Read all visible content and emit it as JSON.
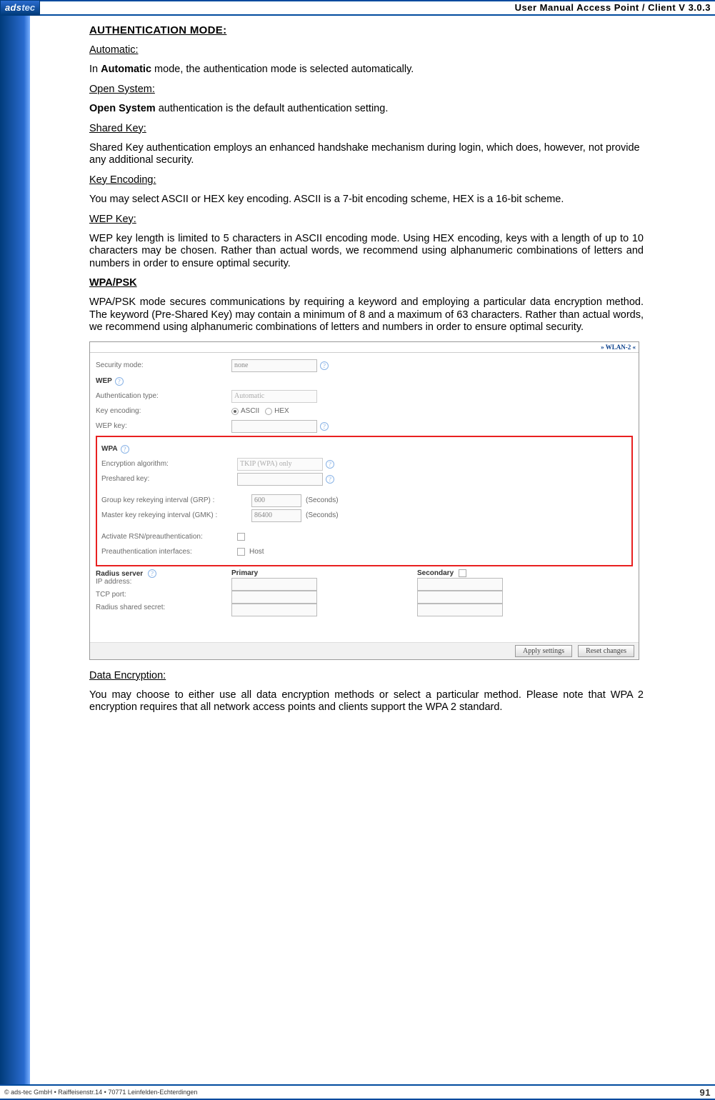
{
  "frame": {
    "logo": {
      "ads": "ads",
      "tec": "tec"
    },
    "title": "User Manual Access  Point / Client V 3.0.3",
    "footer_left": "© ads-tec GmbH • Raiffeisenstr.14 • 70771 Leinfelden-Echterdingen",
    "page_number": "91"
  },
  "body": {
    "authmode_heading": "AUTHENTICATION MODE:",
    "automatic_h": "Automatic:",
    "automatic_p_pre": "In ",
    "automatic_p_bold": "Automatic",
    "automatic_p_post": " mode, the authentication mode is selected automatically.",
    "opensys_h": "Open System:",
    "opensys_p_bold": "Open System",
    "opensys_p_post": " authentication is the default authentication setting.",
    "sharedkey_h": "Shared Key:",
    "sharedkey_p": "Shared Key authentication employs an enhanced handshake mechanism during login, which does, however, not provide any additional security.",
    "keyenc_h": "Key Encoding:",
    "keyenc_p": "You may select ASCII or HEX key encoding. ASCII is a 7-bit encoding scheme, HEX is a 16-bit scheme.",
    "wepkey_h": "WEP Key:",
    "wepkey_p": "WEP key length is limited to 5 characters in ASCII encoding mode. Using HEX encoding, keys with a length of up to 10 characters may be chosen. Rather than actual words, we recommend using alphanumeric combinations of letters and numbers in order to ensure optimal security.",
    "wpapsk_h": "WPA/PSK",
    "wpapsk_p": "WPA/PSK mode secures communications by requiring a keyword and employing a particular data encryption method. The keyword (Pre-Shared Key) may contain a minimum of 8 and a maximum of 63 characters. Rather than actual words, we recommend using alphanumeric combinations of letters and numbers in order to ensure optimal security.",
    "dataenc_h": "Data Encryption:",
    "dataenc_p": "You may choose to either use all data encryption methods or select a particular method. Please note that WPA 2 encryption requires that all network access points and clients support the WPA 2 standard."
  },
  "shot": {
    "head": "» WLAN-2 «",
    "security_mode_lbl": "Security mode:",
    "security_mode_val": "none",
    "wep_title": "WEP",
    "auth_type_lbl": "Authentication type:",
    "auth_type_val": "Automatic",
    "key_encoding_lbl": "Key encoding:",
    "key_encoding_opts": [
      "ASCII",
      "HEX"
    ],
    "wep_key_lbl": "WEP key:",
    "wep_key_val": "",
    "wpa_title": "WPA",
    "enc_alg_lbl": "Encryption algorithm:",
    "enc_alg_val": "TKIP (WPA) only",
    "preshared_lbl": "Preshared key:",
    "preshared_val": "",
    "grp_lbl": "Group key rekeying interval (GRP) :",
    "grp_val": "600",
    "gmk_lbl": "Master key rekeying interval (GMK) :",
    "gmk_val": "86400",
    "seconds": "(Seconds)",
    "rsn_lbl": "Activate RSN/preauthentication:",
    "preauth_if_lbl": "Preauthentication interfaces:",
    "preauth_if_opt": "Host",
    "radius_title": "Radius server",
    "primary": "Primary",
    "secondary": "Secondary",
    "ip_lbl": "IP address:",
    "tcp_lbl": "TCP port:",
    "secret_lbl": "Radius shared secret:",
    "btn_apply": "Apply settings",
    "btn_reset": "Reset changes"
  }
}
